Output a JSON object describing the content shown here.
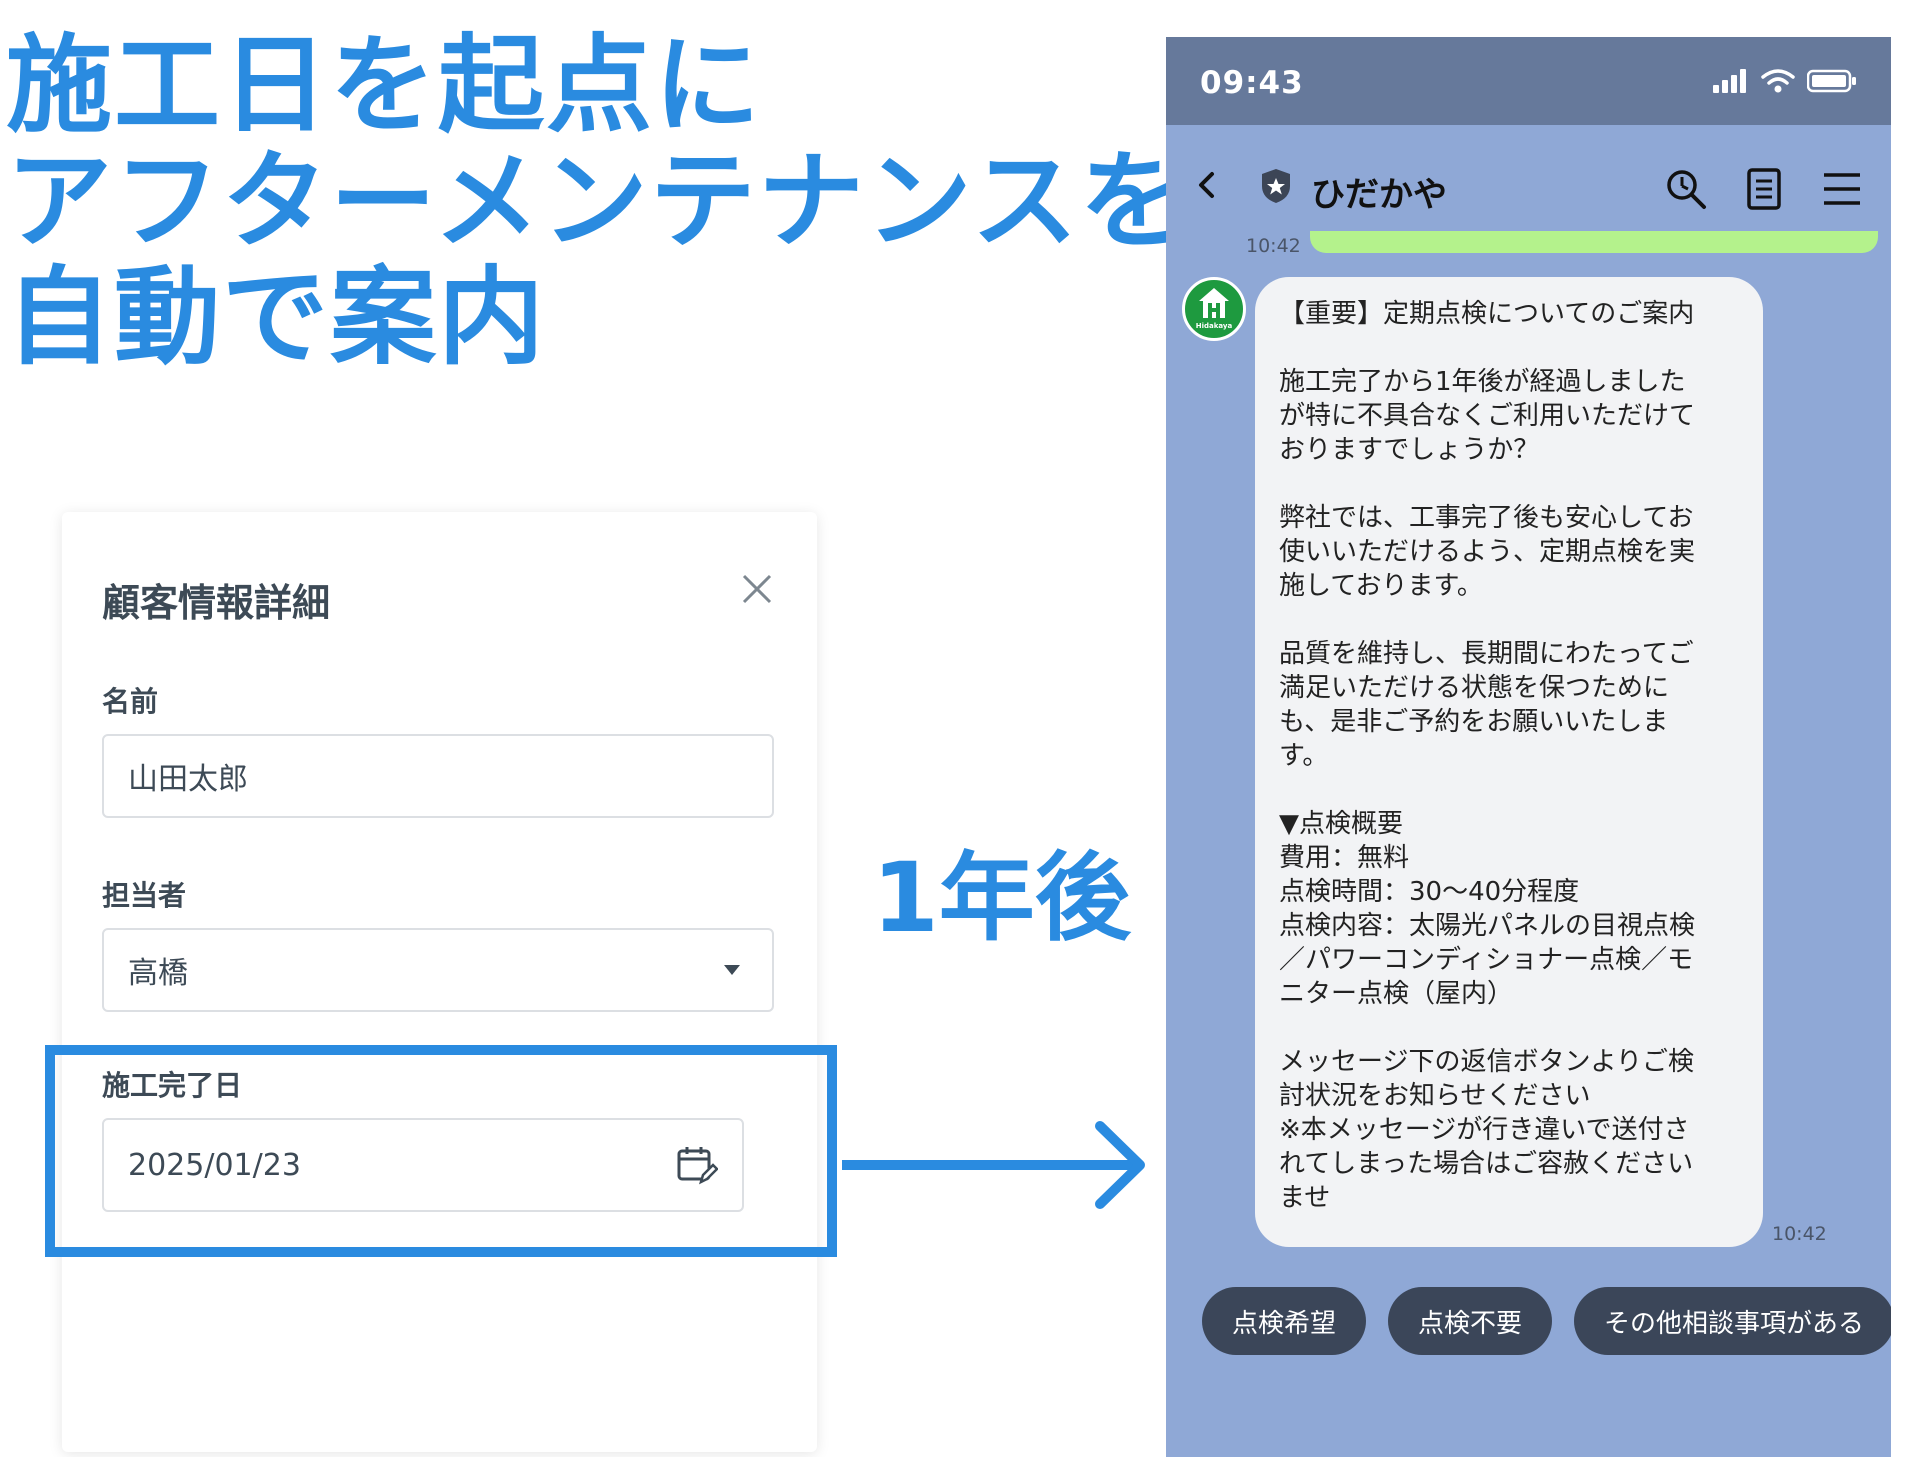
{
  "headline": {
    "line1": "施工日を起点に",
    "line2": "アフターメンテナンスを",
    "line3": "自動で案内"
  },
  "panel": {
    "title": "顧客情報詳細",
    "close_icon": "close-icon",
    "fields": {
      "name": {
        "label": "名前",
        "value": "山田太郎"
      },
      "assignee": {
        "label": "担当者",
        "value": "高橋",
        "icon": "caret-down-icon"
      },
      "completion_date": {
        "label": "施工完了日",
        "value": "2025/01/23",
        "icon": "calendar-edit-icon"
      }
    }
  },
  "arrow_label": "1年後",
  "phone": {
    "status_time": "09:43",
    "chat_name": "ひだかや",
    "prev_timestamp": "10:42",
    "message_timestamp": "10:42",
    "avatar_text": "Hidakaya",
    "message": "【重要】定期点検についてのご案内\n\n施工完了から1年後が経過しました\nが特に不具合なくご利用いただけて\nおりますでしょうか？\n\n弊社では、工事完了後も安心してお\n使いいただけるよう、定期点検を実\n施しております。\n\n品質を維持し、長期間にわたってご\n満足いただける状態を保つために\nも、是非ご予約をお願いいたしま\nす。\n\n▼点検概要\n費用：無料\n点検時間：30〜40分程度\n点検内容：太陽光パネルの目視点検\n／パワーコンディショナー点検／モ\nニター点検（屋内）\n\nメッセージ下の返信ボタンよりご検\n討状況をお知らせください\n※本メッセージが行き違いで送付さ\nれてしまった場合はご容赦ください\nませ",
    "quick_replies": [
      "点検希望",
      "点検不要",
      "その他相談事項がある"
    ],
    "colors": {
      "status_bar": "#66799b",
      "chat_bg": "#8fa8d6",
      "accent": "#2a8be0"
    }
  }
}
